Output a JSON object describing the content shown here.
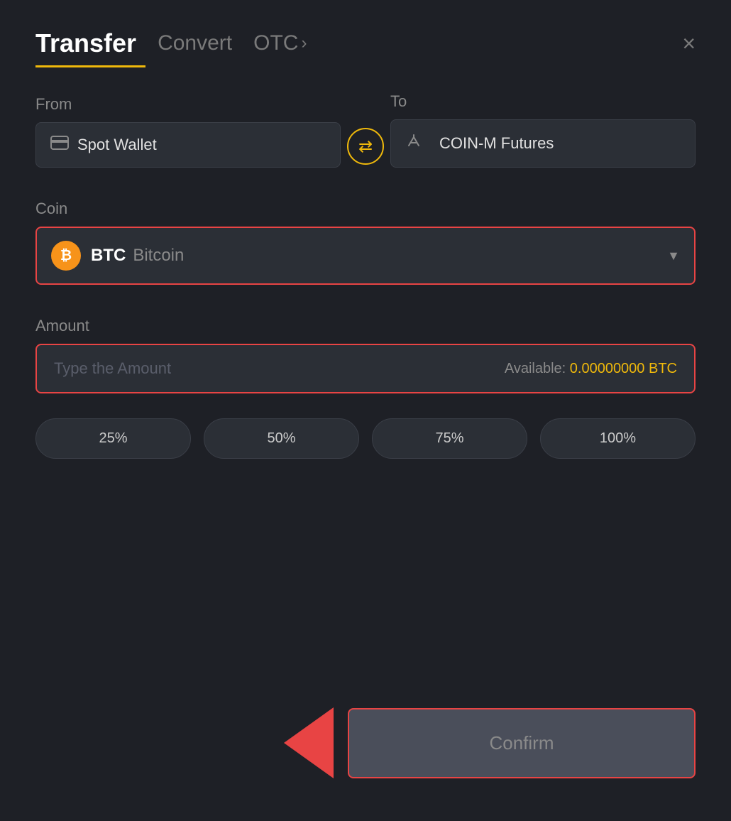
{
  "modal": {
    "title": "Transfer",
    "tabs": [
      {
        "label": "Convert",
        "active": false
      },
      {
        "label": "OTC",
        "active": false
      }
    ],
    "close_label": "×"
  },
  "from": {
    "label": "From",
    "wallet": "Spot Wallet"
  },
  "to": {
    "label": "To",
    "wallet": "COIN-M Futures"
  },
  "swap_icon": "⇄",
  "coin": {
    "label": "Coin",
    "symbol": "BTC",
    "name": "Bitcoin",
    "chevron": "▼"
  },
  "amount": {
    "label": "Amount",
    "placeholder": "Type the Amount",
    "available_label": "Available:",
    "available_value": "0.00000000 BTC"
  },
  "percent_buttons": [
    "25%",
    "50%",
    "75%",
    "100%"
  ],
  "confirm_button": "Confirm"
}
